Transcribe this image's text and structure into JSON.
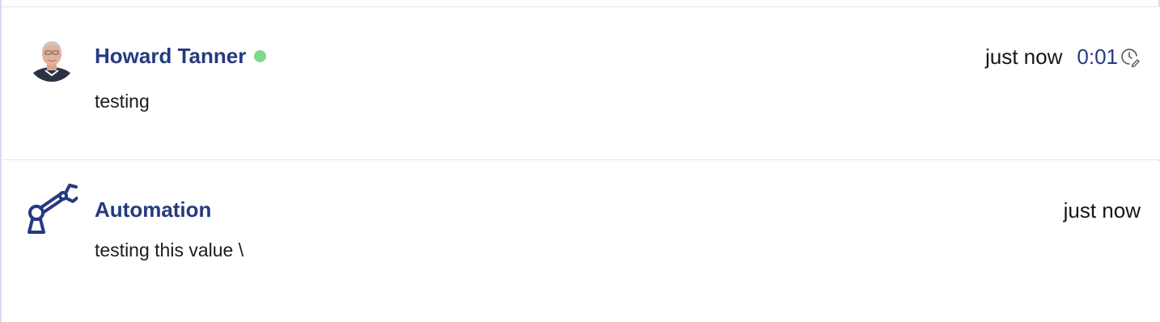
{
  "entries": [
    {
      "author": "Howard Tanner",
      "online": true,
      "timestamp": "just now",
      "duration": "0:01",
      "body": "testing",
      "avatar_icon": "user-photo"
    },
    {
      "author": "Automation",
      "timestamp": "just now",
      "body": "testing this value \\",
      "avatar_icon": "robot-arm-icon"
    }
  ],
  "colors": {
    "author": "#253a80",
    "online": "#7fd98a",
    "divider": "#e3e6ee",
    "frame_border": "#d6dcf2"
  }
}
